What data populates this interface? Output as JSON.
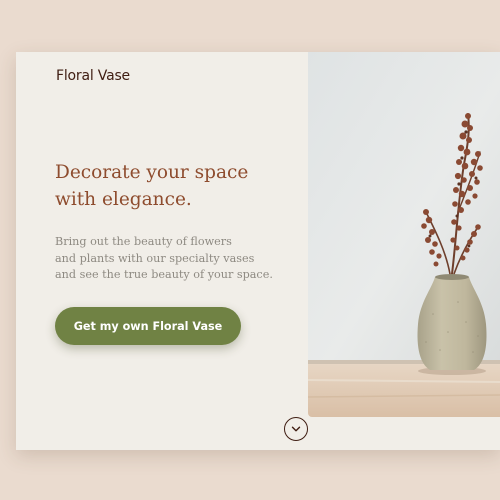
{
  "brand": {
    "name": "Floral Vase"
  },
  "hero": {
    "headline_line1": "Decorate your space",
    "headline_line2": "with elegance.",
    "body_line1": "Bring out the beauty of flowers",
    "body_line2": "and plants with our specialty vases",
    "body_line3": "and see the true beauty of your space.",
    "cta_label": "Get my own Floral Vase"
  },
  "icons": {
    "scroll": "chevron-down-icon",
    "photo": "vase-with-dried-flowers-photo"
  },
  "colors": {
    "page_background": "#eadbcf",
    "card_background": "#f1eee8",
    "brand_text": "#3f1d12",
    "headline_text": "#8e4c2e",
    "body_text": "#8e8a82",
    "cta_background": "#708244",
    "cta_text": "#ffffff"
  }
}
